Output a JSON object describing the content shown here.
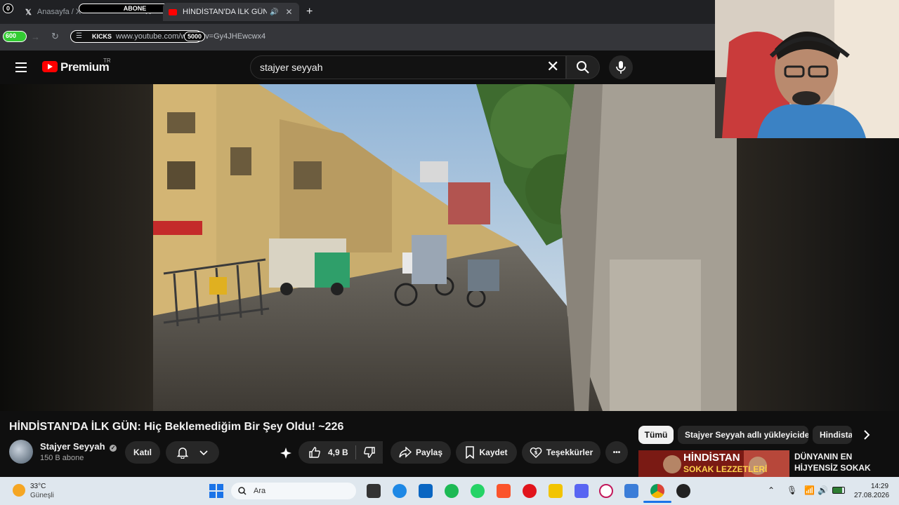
{
  "browser": {
    "tabs": [
      {
        "title": "Anasayfa / X",
        "active": false
      },
      {
        "title": "HİNDİSTAN'DA İLK GÜN: Hi",
        "active": true
      }
    ],
    "new_tab": "+",
    "url": "https://www.youtube.com/watch?v=Gy4JHEwcwx4",
    "url_visible": "www.youtube.com/watch?v=Gy4JHEwcwx4"
  },
  "overlay_badges": {
    "abone_label": "ABONE",
    "abone_left": "0",
    "abone_right": "20",
    "kicks_label": "KICKS",
    "kicks_left": "600",
    "kicks_right": "5000"
  },
  "youtube": {
    "brand": "Premium",
    "region": "TR",
    "search_value": "stajyer seyyah"
  },
  "video": {
    "title": "HİNDİSTAN'DA İLK GÜN: Hiç Beklemediğim Bir Şey Oldu! ~226",
    "channel": "Stajyer Seyyah",
    "subscribers": "150 B abone",
    "join_label": "Katıl",
    "likes": "4,9 B",
    "share_label": "Paylaş",
    "save_label": "Kaydet",
    "thanks_label": "Teşekkürler",
    "more_label": "•••"
  },
  "chips": [
    "Tümü",
    "Stajyer Seyyah adlı yükleyiciden",
    "Hindista"
  ],
  "recommendation": {
    "thumb_line1": "HİNDİSTAN",
    "thumb_line2": "SOKAK LEZZETLERİ",
    "title": "DÜNYANIN EN HİJYENSİZ SOKAK"
  },
  "taskbar": {
    "weather_temp": "33°C",
    "weather_desc": "Güneşli",
    "search_placeholder": "Ara",
    "time": "14:29",
    "date": "27.08.2026"
  },
  "colors": {
    "yt_red": "#ff0000",
    "background": "#0f0f0f",
    "chip_active": "#f1f1f1"
  }
}
